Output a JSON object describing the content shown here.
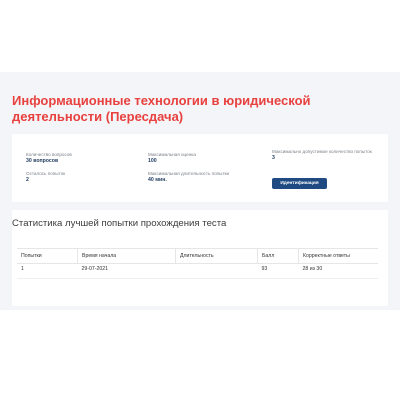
{
  "page": {
    "title": "Информационные технологии в юридической деятельности (Пересдача)"
  },
  "info": {
    "questions_label": "Количество вопросов",
    "questions_value": "30 вопросов",
    "max_score_label": "Максимальная оценка",
    "max_score_value": "100",
    "max_attempts_label": "Максимально допустимое количество попыток",
    "max_attempts_value": "3",
    "attempts_left_label": "Осталось попыток",
    "attempts_left_value": "2",
    "max_duration_label": "Максимальная длительность попытки",
    "max_duration_value": "40 мин.",
    "identify_button": "Идентификация"
  },
  "stats": {
    "title": "Статистика лучшей попытки прохождения теста",
    "columns": [
      "Попытки",
      "Время начала",
      "Длительность",
      "Балл",
      "Корректные ответы"
    ],
    "rows": [
      [
        "1",
        "29-07-2021",
        "",
        "93",
        "28 из 30"
      ]
    ]
  },
  "colors": {
    "accent": "#e8413f",
    "button": "#1f4b82",
    "panel": "#f3f5f8"
  }
}
